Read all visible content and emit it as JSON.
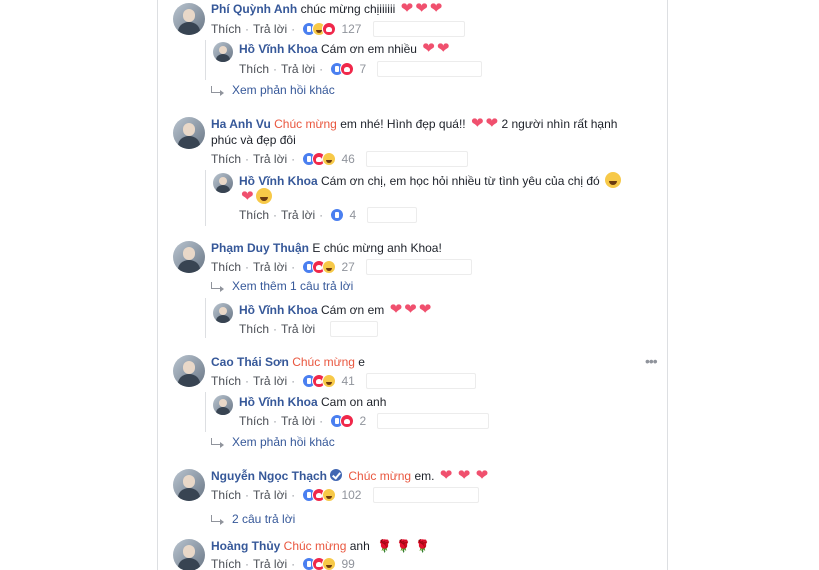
{
  "ui": {
    "like": "Thích",
    "reply": "Trả lời",
    "dot": "·",
    "heart": "❤",
    "rose": "🌹"
  },
  "comments": [
    {
      "name": "Phí Quỳnh Anh",
      "text": "chúc mừng chịiiiiii",
      "count": "127"
    },
    {
      "name": "Hồ Vĩnh Khoa",
      "text": "Cám ơn em nhiều",
      "count": "7"
    },
    {
      "more": "Xem phản hồi khác"
    },
    {
      "name": "Ha Anh Vu",
      "mention": "Chúc mừng",
      "text": "em nhé! Hình đẹp quá!!",
      "text2": "2 người nhìn rất hạnh",
      "text3": "phúc và đẹp đôi",
      "count": "46"
    },
    {
      "name": "Hồ Vĩnh Khoa",
      "text": "Cám ơn chị, em học hỏi nhiều từ tình yêu của chị đó",
      "count": "4"
    },
    {
      "name": "Phạm Duy Thuận",
      "text": "E chúc mừng anh Khoa!",
      "count": "27"
    },
    {
      "more": "Xem thêm 1 câu trả lời"
    },
    {
      "name": "Hồ Vĩnh Khoa",
      "text": "Cám ơn em"
    },
    {
      "name": "Cao Thái Sơn",
      "mention": "Chúc mừng",
      "text": "e",
      "count": "41"
    },
    {
      "name": "Hồ Vĩnh Khoa",
      "text": "Cam on anh",
      "count": "2"
    },
    {
      "more": "Xem phản hồi khác"
    },
    {
      "name": "Nguyễn Ngọc Thạch",
      "mention": "Chúc mừng",
      "text": "em.",
      "count": "102"
    },
    {
      "more": "2 câu trả lời"
    },
    {
      "name": "Hoàng Thủy",
      "mention": "Chúc mừng",
      "text": "anh",
      "count": "99"
    }
  ],
  "colors": {
    "name": "#365899",
    "mention": "#e9573f",
    "heart": "#f0506e",
    "like": "#4a7ff0",
    "love": "#f0284a",
    "haha": "#f7c948"
  },
  "icons": {
    "options": "more-options-icon",
    "reply_arrow": "reply-arrow-icon",
    "verified": "verified-badge-icon"
  }
}
